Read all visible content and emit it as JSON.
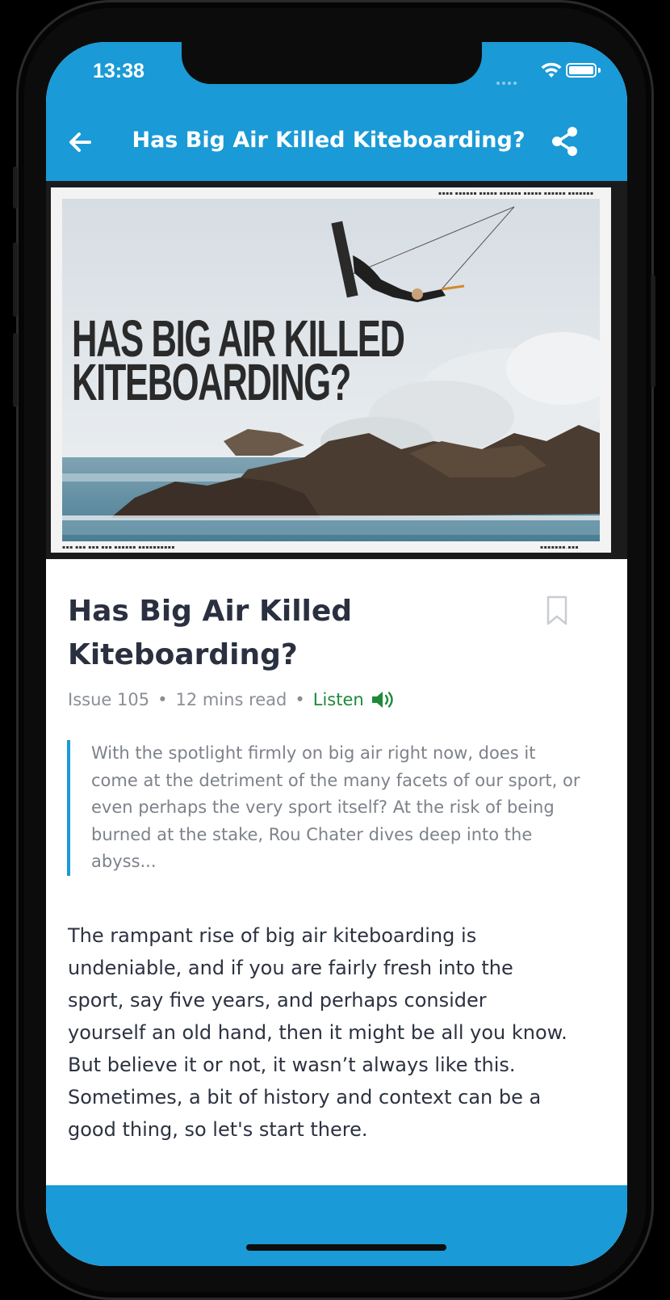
{
  "status_bar": {
    "time": "13:38",
    "icons": [
      "signal-dots-icon",
      "wifi-icon",
      "battery-icon"
    ]
  },
  "app_bar": {
    "title": "Has Big Air Killed Kiteboarding?",
    "back_icon": "arrow-left-icon",
    "share_icon": "share-icon",
    "color": "#1a9ad6"
  },
  "hero": {
    "headline": "HAS BIG AIR KILLED\nKITEBOARDING?"
  },
  "article": {
    "title": "Has Big Air Killed Kiteboarding?",
    "bookmark_icon": "bookmark-icon",
    "issue": "Issue 105",
    "read_time": "12 mins read",
    "listen_label": "Listen",
    "speaker_icon": "speaker-icon",
    "listen_color": "#1e8a3a",
    "quote": "With the spotlight firmly on big air right now, does it come at the detriment of the many facets of our sport, or even perhaps the very sport itself? At the risk of being burned at the stake, Rou Chater dives deep into the abyss...",
    "body": "The rampant rise of big air kiteboarding is undeniable, and if you are fairly fresh into the sport, say five years, and perhaps consider yourself an old hand, then it might be all you know. But believe it or not, it wasn’t always like this. Sometimes, a bit of history and context can be a good thing, so let's start there."
  }
}
